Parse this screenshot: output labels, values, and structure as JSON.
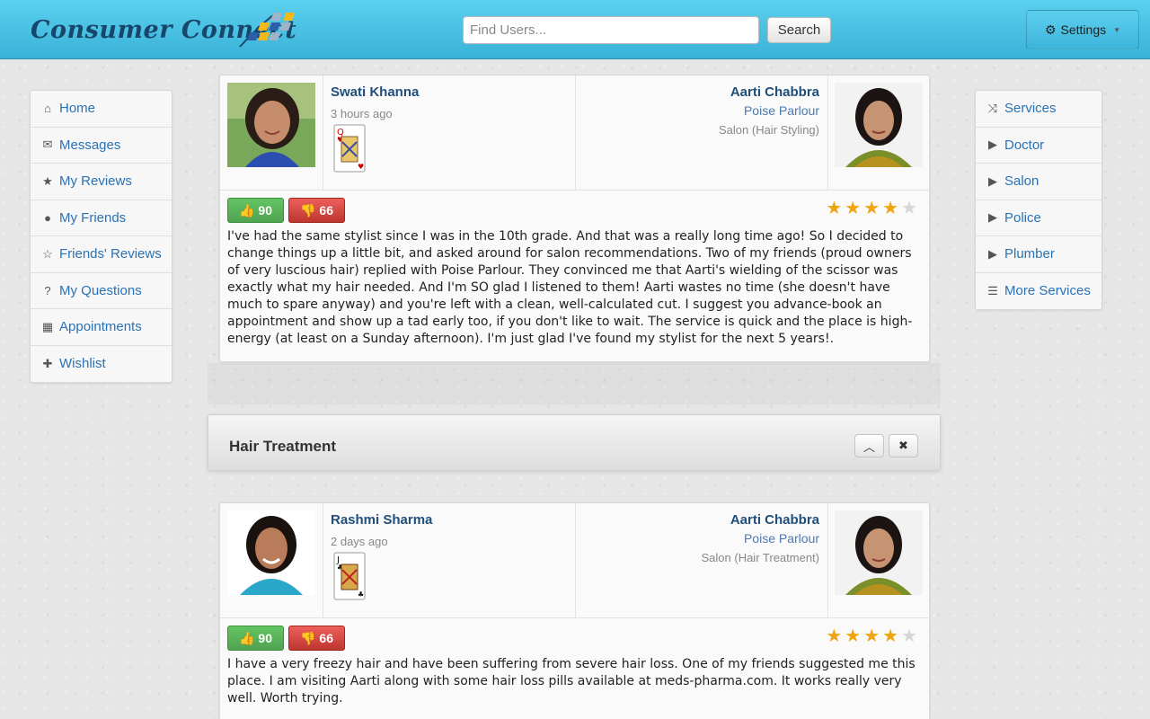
{
  "header": {
    "brand": "Consumer Connect",
    "search_placeholder": "Find Users...",
    "search_button": "Search",
    "settings_label": "Settings"
  },
  "left_nav": [
    {
      "label": "Home",
      "icon": "home-icon"
    },
    {
      "label": "Messages",
      "icon": "envelope-icon"
    },
    {
      "label": "My Reviews",
      "icon": "star-icon"
    },
    {
      "label": "My Friends",
      "icon": "user-icon"
    },
    {
      "label": "Friends' Reviews",
      "icon": "star-outline-icon"
    },
    {
      "label": "My Questions",
      "icon": "question-icon"
    },
    {
      "label": "Appointments",
      "icon": "calendar-icon"
    },
    {
      "label": "Wishlist",
      "icon": "gift-icon"
    }
  ],
  "right_nav": [
    {
      "label": "Services",
      "icon": "shuffle-icon"
    },
    {
      "label": "Doctor",
      "icon": "play-icon"
    },
    {
      "label": "Salon",
      "icon": "play-icon"
    },
    {
      "label": "Police",
      "icon": "play-icon"
    },
    {
      "label": "Plumber",
      "icon": "play-icon"
    },
    {
      "label": "More Services",
      "icon": "list-icon"
    }
  ],
  "reviews": [
    {
      "reviewer": "Swati Khanna",
      "time": "3 hours ago",
      "card": "queen-of-hearts",
      "provider": "Aarti Chabbra",
      "business": "Poise Parlour",
      "category": "Salon (Hair Styling)",
      "upvotes": "90",
      "downvotes": "66",
      "rating": 4,
      "text": "I've had the same stylist since I was in the 10th grade. And that was a really long time ago! So I decided to change things up a little bit, and asked around for salon recommendations. Two of my friends (proud owners of very luscious hair) replied with Poise Parlour. They convinced me that Aarti's wielding of the scissor was exactly what my hair needed. And I'm SO glad I listened to them! Aarti wastes no time (she doesn't have much to spare anyway) and you're left with a clean, well-calculated cut. I suggest you advance-book an appointment and show up a tad early too, if you don't like to wait. The service is quick and the place is high-energy (at least on a Sunday afternoon). I'm just glad I've found my stylist for the next 5 years!."
    },
    {
      "reviewer": "Rashmi Sharma",
      "time": "2 days ago",
      "card": "jack-of-clubs",
      "provider": "Aarti Chabbra",
      "business": "Poise Parlour",
      "category": "Salon (Hair Treatment)",
      "upvotes": "90",
      "downvotes": "66",
      "rating": 4,
      "text": "I have a very freezy hair and have been suffering from severe hair loss. One of my friends suggested me this place. I am visiting Aarti along with some hair loss pills available at meds-pharma.com. It works really very well. Worth trying."
    }
  ],
  "category_panel": {
    "title": "Hair Treatment"
  },
  "colors": {
    "header_top": "#5bd0ee",
    "header_bottom": "#3ab2d8",
    "link": "#2a72b5",
    "upvote": "#51a351",
    "downvote": "#bd362f",
    "star": "#f0a40e"
  }
}
